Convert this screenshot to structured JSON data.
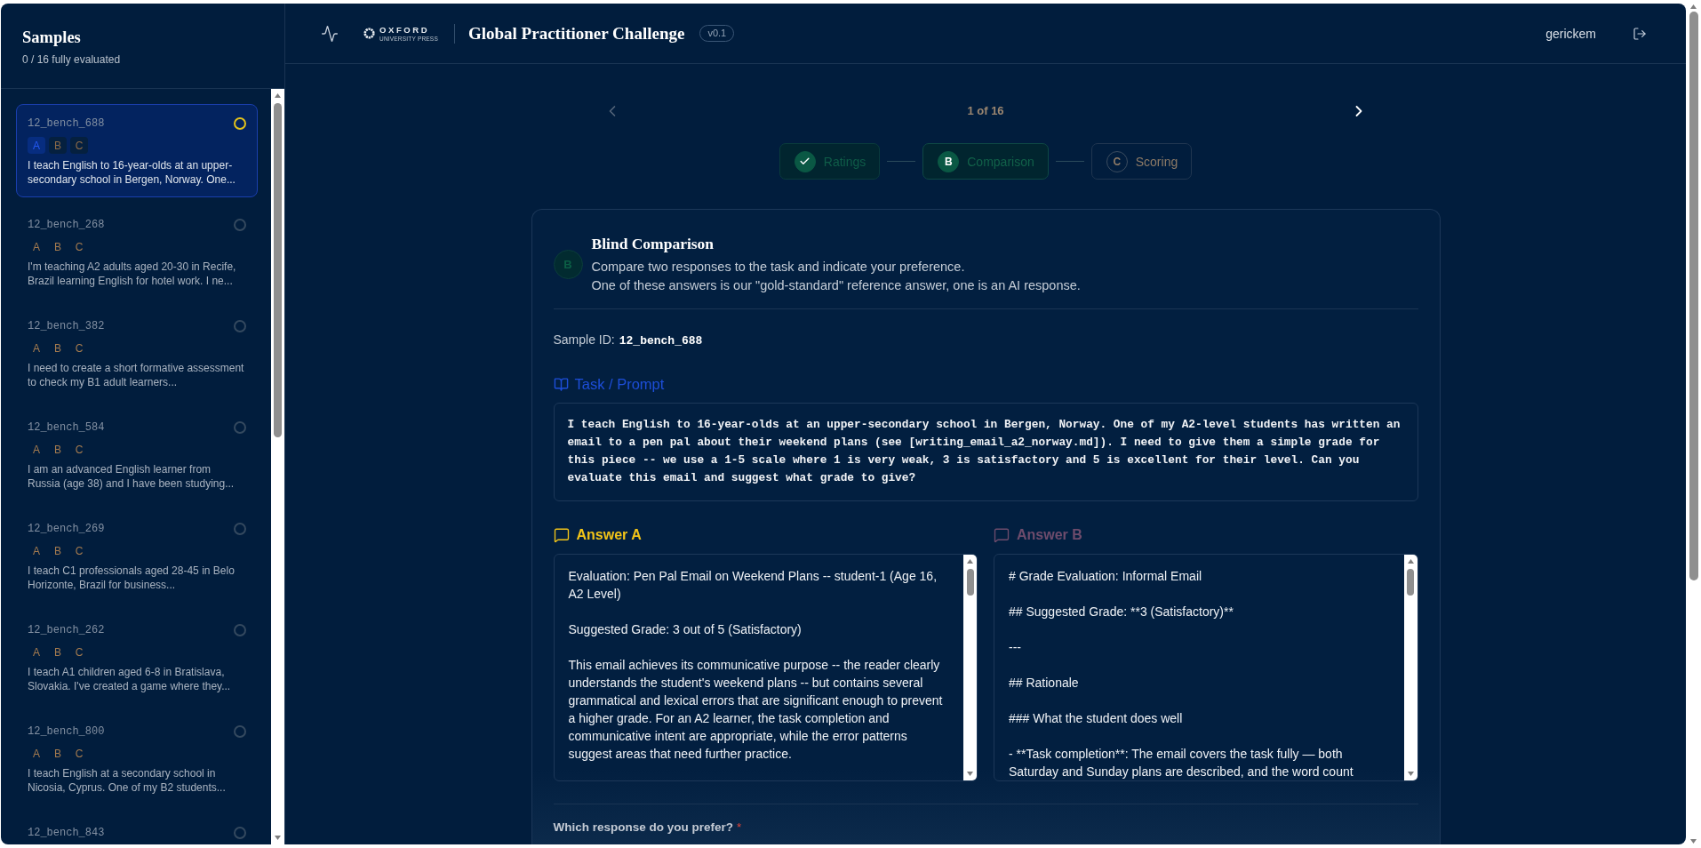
{
  "sidebar": {
    "title": "Samples",
    "progress": "0 / 16 fully evaluated",
    "items": [
      {
        "id": "12_bench_688",
        "color": "#e3c21b",
        "selected": true,
        "options": [
          {
            "label": "A",
            "selected": true
          },
          {
            "label": "B",
            "selected": false
          },
          {
            "label": "C",
            "selected": false
          }
        ],
        "text": "I teach English to 16-year-olds at an upper-secondary school in Bergen, Norway. One..."
      },
      {
        "id": "12_bench_268",
        "color": "#34495f",
        "selected": false,
        "options": [
          {
            "label": "A",
            "selected": false
          },
          {
            "label": "B",
            "selected": false
          },
          {
            "label": "C",
            "selected": false
          }
        ],
        "text": "I'm teaching A2 adults aged 20-30 in Recife, Brazil learning English for hotel work. I ne..."
      },
      {
        "id": "12_bench_382",
        "color": "#34495f",
        "selected": false,
        "options": [
          {
            "label": "A",
            "selected": false
          },
          {
            "label": "B",
            "selected": false
          },
          {
            "label": "C",
            "selected": false
          }
        ],
        "text": "I need to create a short formative assessment to check my B1 adult learners..."
      },
      {
        "id": "12_bench_584",
        "color": "#34495f",
        "selected": false,
        "options": [
          {
            "label": "A",
            "selected": false
          },
          {
            "label": "B",
            "selected": false
          },
          {
            "label": "C",
            "selected": false
          }
        ],
        "text": "I am an advanced English learner from Russia (age 38) and I have been studying..."
      },
      {
        "id": "12_bench_269",
        "color": "#34495f",
        "selected": false,
        "options": [
          {
            "label": "A",
            "selected": false
          },
          {
            "label": "B",
            "selected": false
          },
          {
            "label": "C",
            "selected": false
          }
        ],
        "text": "I teach C1 professionals aged 28-45 in Belo Horizonte, Brazil for business..."
      },
      {
        "id": "12_bench_262",
        "color": "#34495f",
        "selected": false,
        "options": [
          {
            "label": "A",
            "selected": false
          },
          {
            "label": "B",
            "selected": false
          },
          {
            "label": "C",
            "selected": false
          }
        ],
        "text": "I teach A1 children aged 6-8 in Bratislava, Slovakia. I've created a game where they..."
      },
      {
        "id": "12_bench_800",
        "color": "#34495f",
        "selected": false,
        "options": [
          {
            "label": "A",
            "selected": false
          },
          {
            "label": "B",
            "selected": false
          },
          {
            "label": "C",
            "selected": false
          }
        ],
        "text": "I teach English at a secondary school in Nicosia, Cyprus. One of my B2 students..."
      },
      {
        "id": "12_bench_843",
        "color": "#34495f",
        "selected": false
      }
    ]
  },
  "header": {
    "logo": {
      "wordmark": "OXFORD",
      "tagline": "UNIVERSITY PRESS"
    },
    "title": "Global Practitioner Challenge",
    "version": "v0.1",
    "user": "gerickem"
  },
  "pager": {
    "position": "1 of 16",
    "prev_disabled": true,
    "next_disabled": false
  },
  "steps": [
    {
      "label": "Ratings",
      "completed": true,
      "selected": false
    },
    {
      "letter": "B",
      "label": "Comparison",
      "completed": false,
      "selected": true
    },
    {
      "letter": "C",
      "label": "Scoring",
      "completed": false,
      "selected": false
    }
  ],
  "panel": {
    "badge": "B",
    "title": "Blind Comparison",
    "description": [
      "Compare two responses to the task and indicate your preference.",
      "One of these answers is our \"gold-standard\" reference answer, one is an AI response."
    ],
    "sample_id_label": "Sample ID:",
    "sample_id": "12_bench_688",
    "task_label": "Task / Prompt",
    "prompt": "I teach English to 16-year-olds at an upper-secondary school in Bergen, Norway. One of my A2-level students has written an email to a pen pal about their weekend plans (see [writing_email_a2_norway.md]). I need to give them a simple grade for this piece -- we use a 1-5 scale where 1 is very weak, 3 is satisfactory and 5 is excellent for their level. Can you evaluate this email and suggest what grade to give?",
    "answers": [
      {
        "label": "Answer A",
        "active": true,
        "paragraphs": [
          "Evaluation: Pen Pal Email on Weekend Plans -- student-1 (Age 16, A2 Level)",
          "Suggested Grade: 3 out of 5 (Satisfactory)",
          "This email achieves its communicative purpose -- the reader clearly understands the student's weekend plans -- but contains several grammatical and lexical errors that are significant enough to prevent a higher grade. For an A2 learner, the task completion and communicative intent are appropriate, while the error patterns suggest areas that need further practice."
        ]
      },
      {
        "label": "Answer B",
        "active": false,
        "paragraphs": [
          "# Grade Evaluation: Informal Email",
          "## Suggested Grade: **3 (Satisfactory)**",
          "---",
          "## Rationale",
          "### What the student does well",
          "- **Task completion**: The email covers the task fully — both Saturday and Sunday plans are described, and the word count"
        ]
      }
    ],
    "question": {
      "label": "Which response do you prefer?",
      "required_mark": "*"
    }
  }
}
